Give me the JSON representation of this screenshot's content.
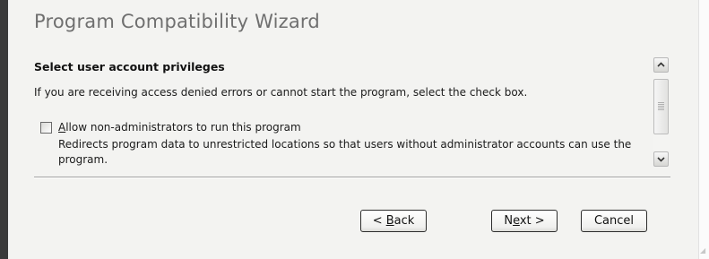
{
  "window": {
    "title": "Program Compatibility Wizard"
  },
  "page": {
    "heading": "Select user account privileges",
    "description": "If you are receiving access denied errors or cannot start the program, select the check box.",
    "option": {
      "label_access_key": "A",
      "label_rest": "llow non-administrators to run this program",
      "checked": false,
      "detail": "Redirects program data to unrestricted locations so that users without administrator accounts can use the program."
    }
  },
  "scrollbar": {
    "up_glyph": "⌃",
    "down_glyph": "⌄",
    "up_icon": "chevron-up-icon",
    "down_icon": "chevron-down-icon"
  },
  "buttons": {
    "back_prefix": "< ",
    "back_access_key": "B",
    "back_rest": "ack",
    "next_prefix": "N",
    "next_access_key": "e",
    "next_rest": "xt >",
    "cancel_label": "Cancel"
  },
  "colors": {
    "panel_background": "#f3f3f1",
    "title_text": "#6f6f6f",
    "window_edge": "#3a3a3a"
  }
}
